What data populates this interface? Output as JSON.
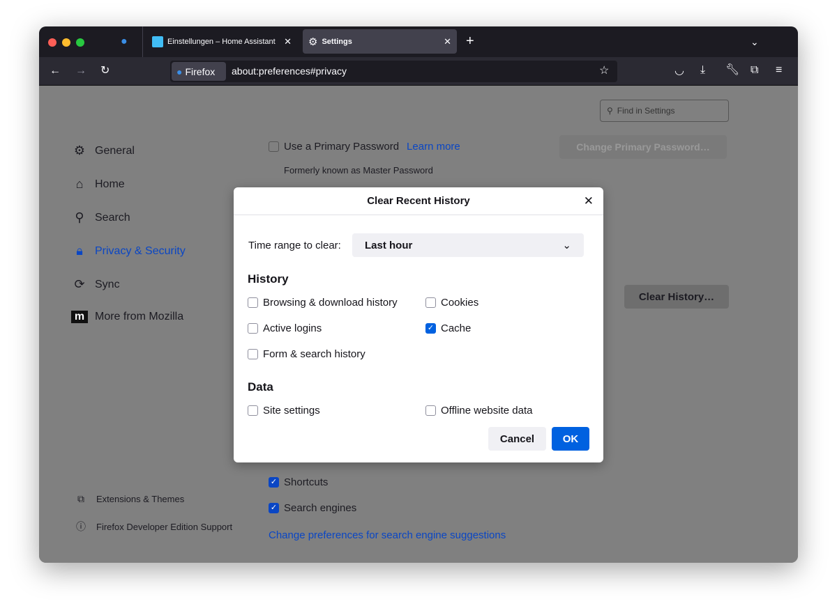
{
  "browser": {
    "tabs": [
      {
        "label": "Einstellungen – Home Assistant",
        "icon": "home-assistant-icon"
      },
      {
        "label": "Settings",
        "icon": "gear-icon",
        "active": true
      }
    ],
    "identity_label": "Firefox",
    "url": "about:preferences#privacy"
  },
  "settings": {
    "search_placeholder": "Find in Settings",
    "sidebar": [
      {
        "label": "General",
        "icon": "gear-icon"
      },
      {
        "label": "Home",
        "icon": "home-icon"
      },
      {
        "label": "Search",
        "icon": "search-icon"
      },
      {
        "label": "Privacy & Security",
        "icon": "lock-icon",
        "active": true
      },
      {
        "label": "Sync",
        "icon": "sync-icon"
      },
      {
        "label": "More from Mozilla",
        "icon": "mozilla-icon"
      }
    ],
    "footer": [
      "Extensions & Themes",
      "Firefox Developer Edition Support"
    ],
    "primary_password": {
      "label": "Use a Primary Password",
      "learn_more": "Learn more",
      "note": "Formerly known as Master Password",
      "button": "Change Primary Password…",
      "checked": false
    },
    "clear_history_button": "Clear History…",
    "shortcuts": {
      "label": "Shortcuts",
      "checked": true
    },
    "search_engines": {
      "label": "Search engines",
      "checked": true
    },
    "search_link": "Change preferences for search engine suggestions"
  },
  "dialog": {
    "title": "Clear Recent History",
    "time_range_label": "Time range to clear:",
    "time_range_value": "Last hour",
    "history_heading": "History",
    "history": [
      {
        "label": "Browsing & download history",
        "checked": false
      },
      {
        "label": "Cookies",
        "checked": false
      },
      {
        "label": "Active logins",
        "checked": false
      },
      {
        "label": "Cache",
        "checked": true
      },
      {
        "label": "Form & search history",
        "checked": false
      }
    ],
    "data_heading": "Data",
    "data": [
      {
        "label": "Site settings",
        "checked": false
      },
      {
        "label": "Offline website data",
        "checked": false
      }
    ],
    "cancel": "Cancel",
    "ok": "OK"
  },
  "colors": {
    "accent": "#0061e0",
    "link": "#0a46c4"
  }
}
